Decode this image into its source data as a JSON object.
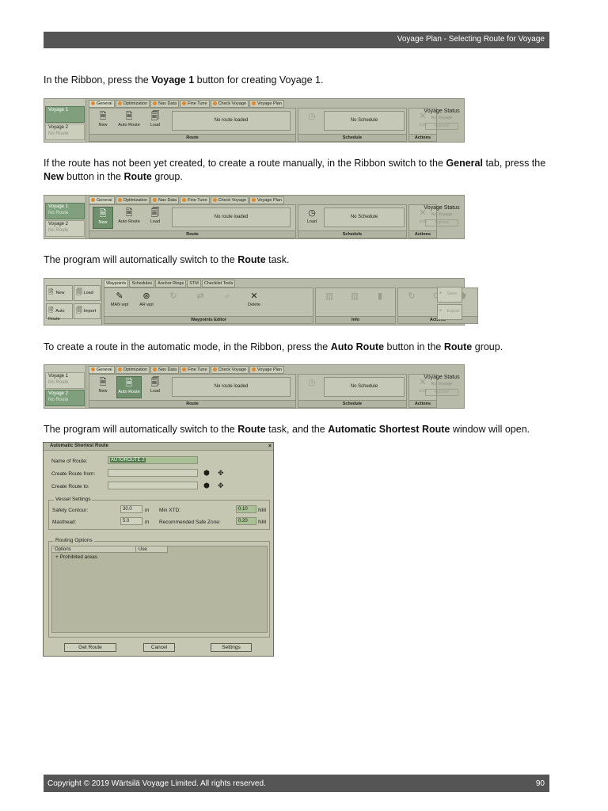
{
  "header": {
    "title": "Voyage Plan - Selecting Route for Voyage"
  },
  "paragraphs": {
    "p1": {
      "a": "In the Ribbon, press the ",
      "b1": "Voyage 1",
      "c": " button for creating Voyage 1."
    },
    "p2": {
      "a": "If the route has not been yet created, to create a route manually, in the Ribbon switch to the ",
      "b1": "General",
      "c": " tab, press the ",
      "b2": "New",
      "d": " button in the ",
      "b3": "Route",
      "e": " group."
    },
    "p3": {
      "a": "The program will automatically switch to the ",
      "b1": "Route",
      "c": " task."
    },
    "p4": {
      "a": "To create a route in the automatic mode, in the Ribbon, press the ",
      "b1": "Auto Route",
      "c": " button in the ",
      "b2": "Route",
      "d": " group."
    },
    "p5": {
      "a": "The program will automatically switch to the ",
      "b1": "Route",
      "c": " task, and the ",
      "b2": "Automatic Shortest Route",
      "d": " window will open."
    }
  },
  "ribbon": {
    "voyage1": "Voyage 1",
    "voyage2": "Voyage 2",
    "no_route": "No Route",
    "tabs": [
      "General",
      "Optimization",
      "Nav Data",
      "Fine Tune",
      "Check Voyage",
      "Voyage Plan"
    ],
    "btn_new": "New",
    "btn_auto_route": "Auto Route",
    "btn_load": "Load",
    "no_route_loaded": "No route loaded",
    "no_schedule": "No Schedule",
    "group_route": "Route",
    "group_schedule": "Schedule",
    "group_actions": "Actions",
    "voyage_status": "Voyage Status",
    "no_voyage": "No Voyage",
    "approve": "Approve",
    "edit": "Edit"
  },
  "route_task": {
    "btn_new": "New",
    "btn_load": "Load",
    "btn_auto_route": "Auto Route",
    "btn_import": "Import",
    "tabs": [
      "Waypoints",
      "Schedules",
      "Anchor Rings",
      "STM",
      "Checklist Tools"
    ],
    "btn_manl_wpt": "MAN wpt",
    "btn_ar_wpt": "AR wpt",
    "btn_delete": "Delete",
    "group_waypoints_editor": "Waypoints Editor",
    "group_info": "Info",
    "group_actions": "Actions",
    "save": "Save",
    "export": "Export"
  },
  "dialog": {
    "title": "Automatic Shortest Route",
    "close": "×",
    "name_label": "Name of Route:",
    "name_value": "AUTOROUTE 2",
    "from_label": "Create Route from:",
    "to_label": "Create Route to:",
    "vessel_settings": "Vessel Settings",
    "safety_contour_label": "Safety Contour:",
    "safety_contour_value": "30.0",
    "unit_m": "m",
    "masthead_label": "Masthead:",
    "masthead_value": "5.0",
    "min_xtd_label": "Min XTD:",
    "min_xtd_value": "0.10",
    "unit_nm": "NM",
    "safe_zone_label": "Recommended Safe Zone:",
    "safe_zone_value": "0.20",
    "routing_options": "Routing Options",
    "col_options": "Options",
    "col_use": "Use",
    "row_prohibited": "Prohibited areas",
    "expand": "+",
    "btn_get_route": "Get Route",
    "btn_cancel": "Cancel",
    "btn_settings": "Settings"
  },
  "footer": {
    "copyright": "Copyright © 2019 Wärtsilä Voyage Limited. All rights reserved.",
    "page": "90"
  }
}
